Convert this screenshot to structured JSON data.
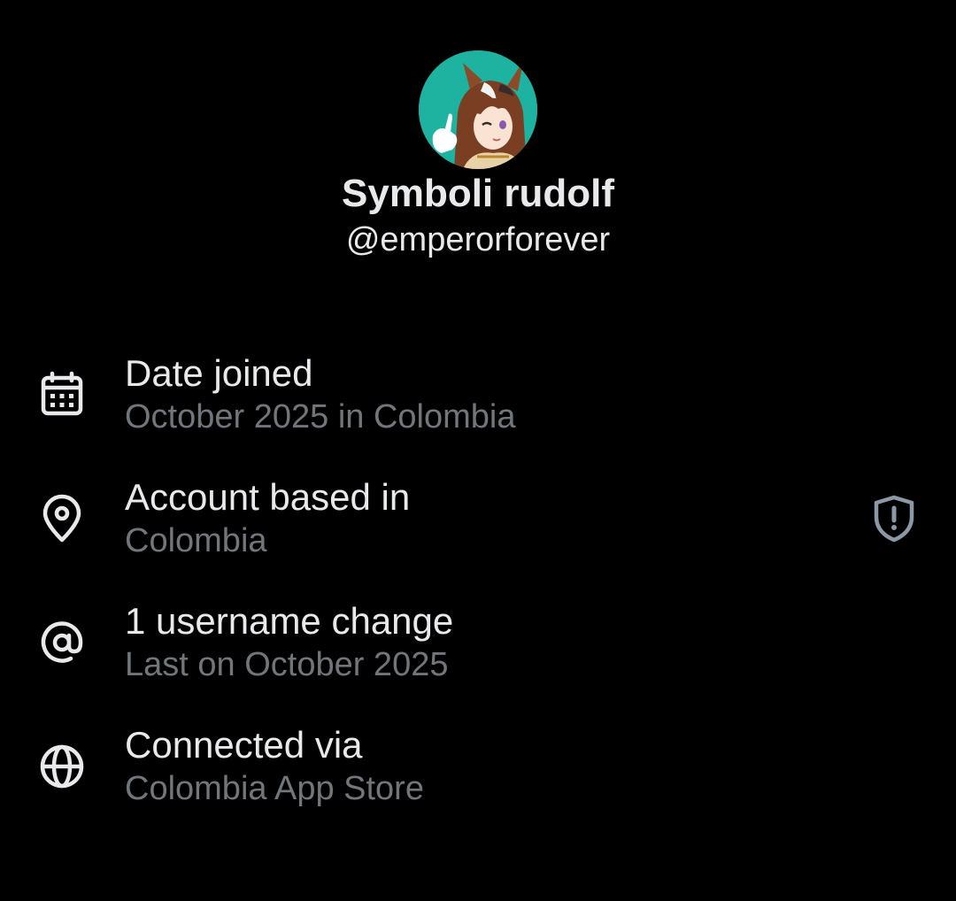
{
  "profile": {
    "display_name": "Symboli rudolf",
    "handle": "@emperorforever",
    "avatar_icon": "anime-character-avatar"
  },
  "about": {
    "items": [
      {
        "icon": "calendar-icon",
        "title": "Date joined",
        "subtitle": "October 2025 in Colombia"
      },
      {
        "icon": "location-pin-icon",
        "title": "Account based in",
        "subtitle": "Colombia",
        "trailing_icon": "shield-alert-icon"
      },
      {
        "icon": "at-sign-icon",
        "title": "1 username change",
        "subtitle": "Last on October 2025"
      },
      {
        "icon": "globe-icon",
        "title": "Connected via",
        "subtitle": "Colombia App Store"
      }
    ]
  },
  "colors": {
    "background": "#000000",
    "primary_text": "#e7e9ea",
    "secondary_text": "#71767b",
    "avatar_bg": "#1db3a0"
  }
}
